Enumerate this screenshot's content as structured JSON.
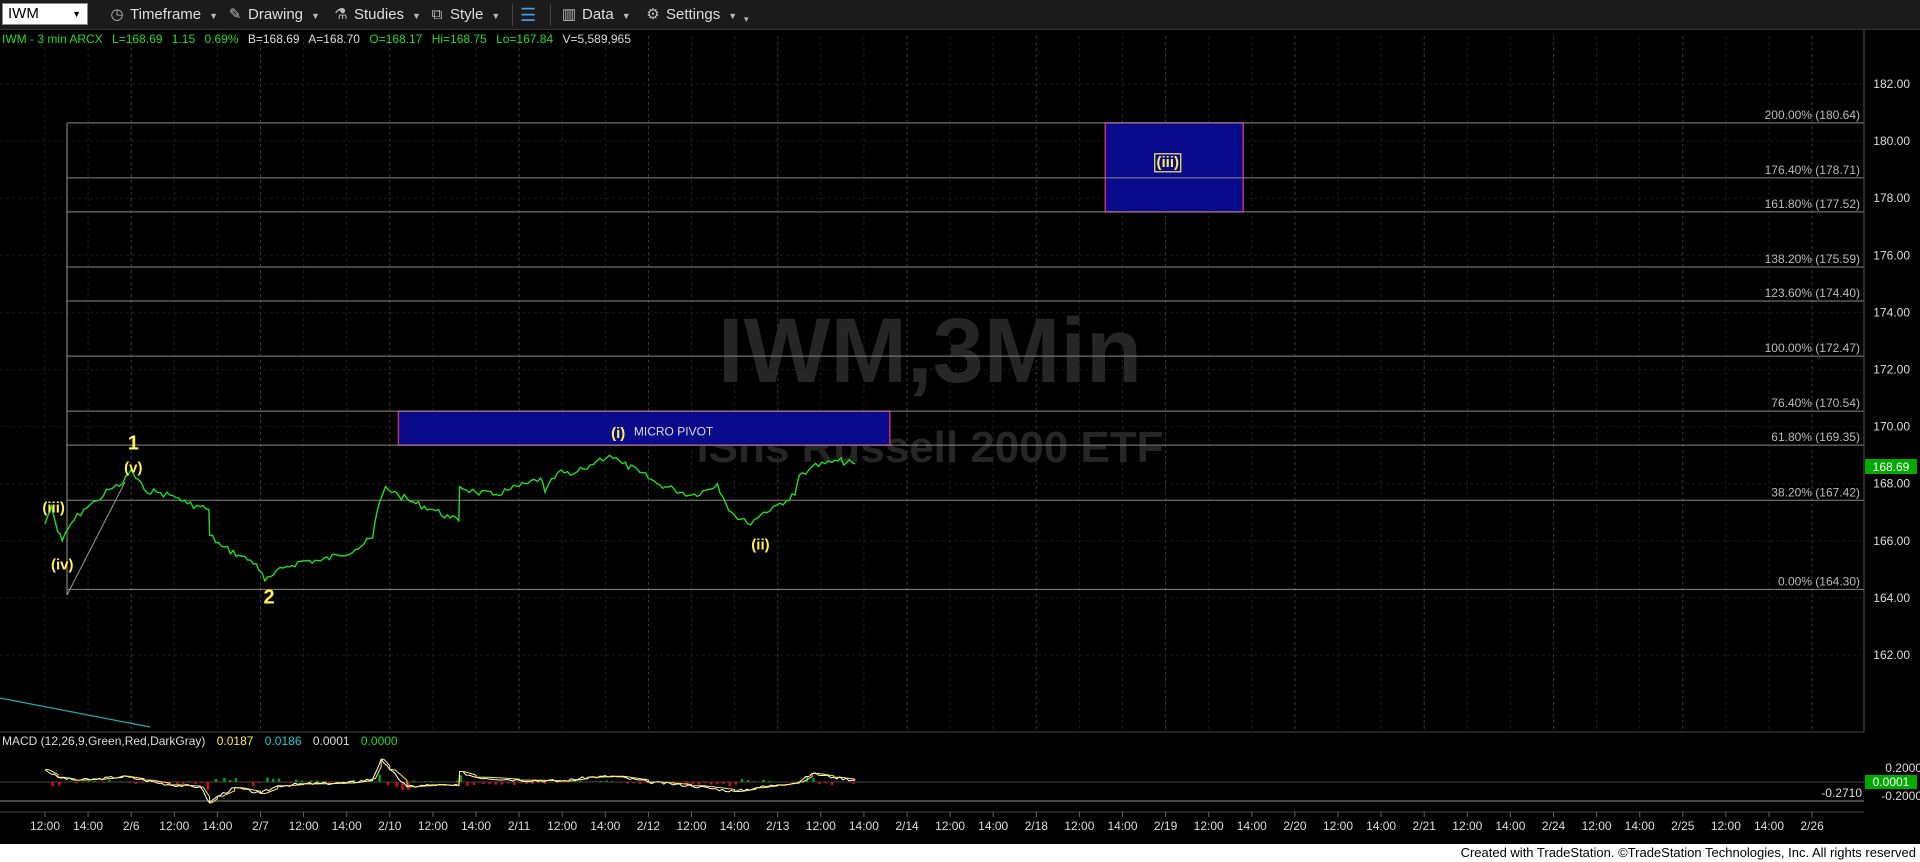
{
  "toolbar": {
    "symbol": "IWM",
    "timeframe": "Timeframe",
    "drawing": "Drawing",
    "studies": "Studies",
    "style": "Style",
    "data": "Data",
    "settings": "Settings"
  },
  "header": {
    "label": "IWM - 3 min  ARCX",
    "last": "L=168.69",
    "change": "1.15",
    "change_pct": "0.69%",
    "bid": "B=168.69",
    "ask": "A=168.70",
    "open": "O=168.17",
    "high": "Hi=168.75",
    "low": "Lo=167.84",
    "volume": "V=5,589,965"
  },
  "watermark": {
    "line1": "IWM,3Min",
    "line2": "iShs Russell 2000 ETF"
  },
  "colors": {
    "price": "#22dd22",
    "label": "#ffee55",
    "zone_fill": "#0a0a8c",
    "zone_border": "#c0306a",
    "last_price_tag": "#00aa00",
    "macd_tag": "#00aa00"
  },
  "price_axis_ticks": [
    "182.00",
    "180.00",
    "178.00",
    "176.00",
    "174.00",
    "172.00",
    "170.00",
    "168.00",
    "166.00",
    "164.00",
    "162.00"
  ],
  "last_price_label": "168.69",
  "fib_levels": [
    {
      "label": "200.00% (180.64)",
      "price": 180.64
    },
    {
      "label": "176.40% (178.71)",
      "price": 178.71
    },
    {
      "label": "161.80% (177.52)",
      "price": 177.52
    },
    {
      "label": "138.20% (175.59)",
      "price": 175.59
    },
    {
      "label": "123.60% (174.40)",
      "price": 174.4
    },
    {
      "label": "100.00% (172.47)",
      "price": 172.47
    },
    {
      "label": "76.40% (170.54)",
      "price": 170.54
    },
    {
      "label": "61.80% (169.35)",
      "price": 169.35
    },
    {
      "label": "38.20% (167.42)",
      "price": 167.42
    },
    {
      "label": "0.00% (164.30)",
      "price": 164.3
    }
  ],
  "zones": [
    {
      "label": "MICRO PIVOT",
      "top": 170.54,
      "bottom": 169.35,
      "x_start": 8.2,
      "x_end": 19.6
    },
    {
      "label": "",
      "top": 180.64,
      "bottom": 177.52,
      "x_start": 24.6,
      "x_end": 27.8
    }
  ],
  "wave_labels": [
    {
      "text": "(iii)",
      "x": 0.2,
      "price": 167.0,
      "boxed": false,
      "big": false
    },
    {
      "text": "(iv)",
      "x": 0.4,
      "price": 165.0,
      "boxed": false,
      "big": false
    },
    {
      "text": "1",
      "x": 2.05,
      "price": 169.2,
      "boxed": false,
      "big": true
    },
    {
      "text": "(v)",
      "x": 2.05,
      "price": 168.4,
      "boxed": false,
      "big": false
    },
    {
      "text": "2",
      "x": 5.2,
      "price": 163.8,
      "boxed": false,
      "big": true
    },
    {
      "text": "(i)",
      "x": 13.3,
      "price": 169.6,
      "boxed": false,
      "big": false
    },
    {
      "text": "(ii)",
      "x": 16.6,
      "price": 165.7,
      "boxed": false,
      "big": false
    },
    {
      "text": "(iii)",
      "x": 26.05,
      "price": 179.1,
      "boxed": true,
      "big": false
    }
  ],
  "macd": {
    "title": "MACD (12,26,9,Green,Red,DarkGray)",
    "values": [
      "0.0187",
      "0.0186",
      "0.0001",
      "0.0000"
    ],
    "axis_ticks": [
      "0.2000",
      "-0.2000"
    ],
    "label_neg": "-0.2710",
    "tag": "0.0001"
  },
  "x_axis_ticks": [
    "12:00",
    "14:00",
    "2/6",
    "12:00",
    "14:00",
    "2/7",
    "12:00",
    "14:00",
    "2/10",
    "12:00",
    "14:00",
    "2/11",
    "12:00",
    "14:00",
    "2/12",
    "12:00",
    "14:00",
    "2/13",
    "12:00",
    "14:00",
    "2/14",
    "12:00",
    "14:00",
    "2/18",
    "12:00",
    "14:00",
    "2/19",
    "12:00",
    "14:00",
    "2/20",
    "12:00",
    "14:00",
    "2/21",
    "12:00",
    "14:00",
    "2/24",
    "12:00",
    "14:00",
    "2/25",
    "12:00",
    "14:00",
    "2/26"
  ],
  "footer": "Created with TradeStation. ©TradeStation Technologies, Inc. All rights reserved",
  "chart_data": {
    "type": "line",
    "title": "IWM - 3 min",
    "ylim": [
      160,
      183
    ],
    "grid": true,
    "series": [
      {
        "x": [
          0,
          0.15,
          0.3,
          0.4,
          0.6,
          0.9,
          1.2,
          1.5,
          1.8,
          2.0,
          2.1,
          2.3,
          2.6,
          2.9,
          3.1,
          3.3,
          3.6,
          3.8,
          3.82,
          4.1,
          4.5,
          4.9,
          5.1,
          5.3,
          5.6,
          6.0,
          6.4,
          6.8,
          7.2,
          7.6,
          7.7,
          7.9,
          8.2,
          8.6,
          9.0,
          9.4,
          9.6,
          9.62,
          10.0,
          10.4,
          10.8,
          11.2,
          11.5,
          11.6,
          11.9,
          12.2,
          12.5,
          12.8,
          13.1,
          13.4,
          13.8,
          14.2,
          14.6,
          15.0,
          15.4,
          15.6,
          15.8,
          16.0,
          16.3,
          16.6,
          16.9,
          17.2,
          17.4,
          17.5,
          17.8,
          18.1,
          18.4,
          18.8
        ],
        "values": [
          166.6,
          167.2,
          166.3,
          166.0,
          166.6,
          167.1,
          167.4,
          167.8,
          168.0,
          168.5,
          168.2,
          167.8,
          167.7,
          167.6,
          167.5,
          167.3,
          167.2,
          167.1,
          166.2,
          165.8,
          165.5,
          165.2,
          164.6,
          164.8,
          165.1,
          165.3,
          165.3,
          165.5,
          165.7,
          166.1,
          167.0,
          167.9,
          167.6,
          167.3,
          167.1,
          166.8,
          166.7,
          167.9,
          167.7,
          167.6,
          167.8,
          168.0,
          168.2,
          167.7,
          168.4,
          168.3,
          168.5,
          168.8,
          169.0,
          168.7,
          168.4,
          168.0,
          167.8,
          167.6,
          167.8,
          168.0,
          167.3,
          166.9,
          166.6,
          166.9,
          167.2,
          167.4,
          167.6,
          168.3,
          168.6,
          168.7,
          168.8,
          168.69
        ]
      }
    ],
    "macd_series": {
      "x": [
        0,
        0.3,
        0.7,
        1.2,
        1.8,
        2.3,
        2.9,
        3.6,
        3.82,
        4.0,
        4.4,
        5.0,
        5.4,
        6.0,
        7.0,
        7.6,
        7.8,
        8.0,
        8.4,
        9.0,
        9.6,
        9.62,
        10.0,
        11.0,
        12.0,
        12.6,
        13.2,
        14.0,
        15.0,
        16.0,
        16.5,
        17.0,
        17.5,
        17.8,
        18.3,
        18.8
      ],
      "values": [
        0.13,
        0.05,
        0.02,
        0.03,
        0.06,
        0.02,
        -0.03,
        -0.05,
        -0.22,
        -0.15,
        -0.06,
        -0.12,
        -0.04,
        -0.02,
        -0.01,
        0.03,
        0.24,
        0.13,
        -0.05,
        -0.03,
        -0.04,
        0.11,
        0.05,
        0.02,
        0.01,
        0.05,
        0.06,
        0.0,
        -0.04,
        -0.1,
        -0.06,
        -0.03,
        0.0,
        0.09,
        0.05,
        0.0187
      ]
    }
  }
}
